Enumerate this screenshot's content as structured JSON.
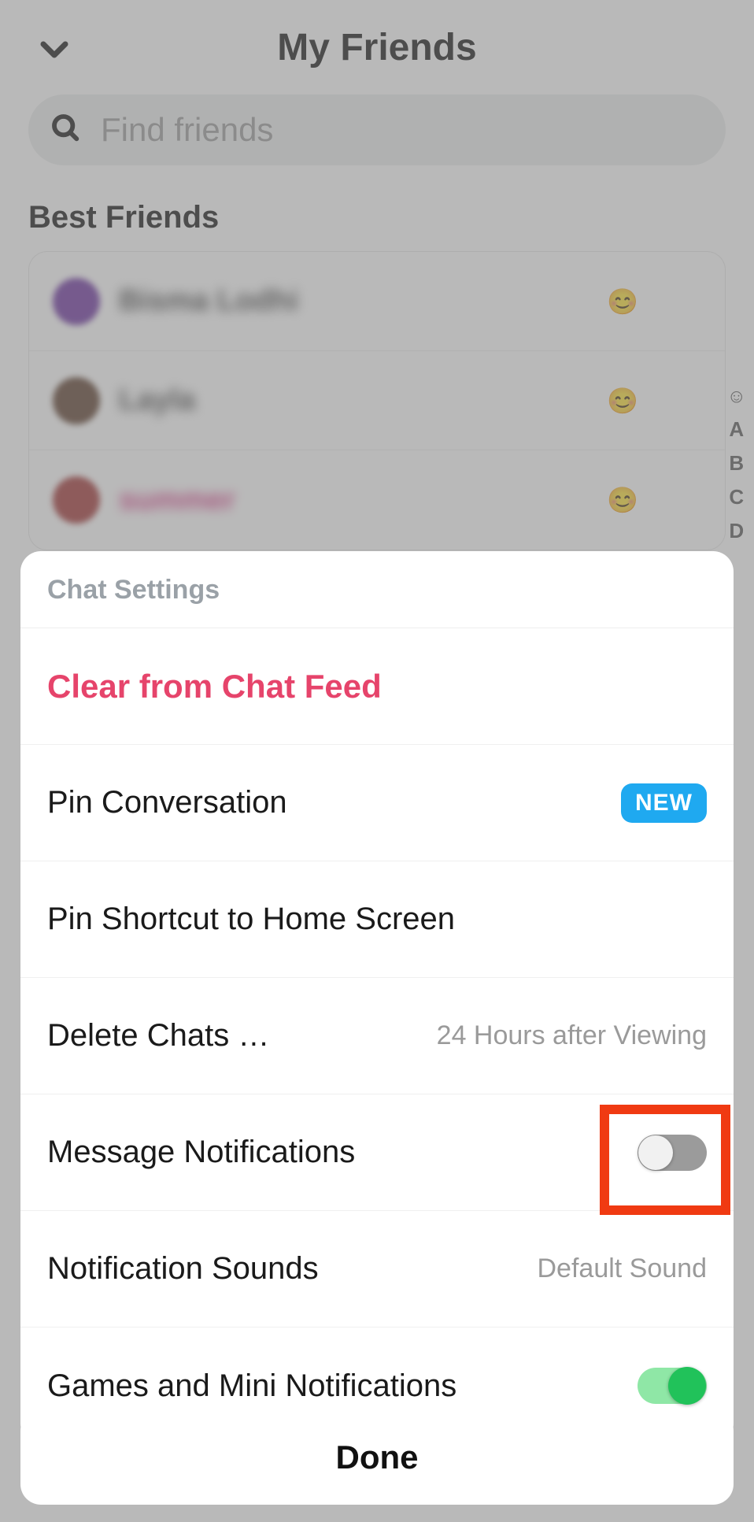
{
  "header": {
    "title": "My Friends"
  },
  "search": {
    "placeholder": "Find friends"
  },
  "section_label": "Best Friends",
  "friends": [
    {
      "name": "Bisma Lodhi",
      "emoji": "😊"
    },
    {
      "name": "Layla",
      "emoji": "😊"
    },
    {
      "name": "summer",
      "emoji": "😊"
    }
  ],
  "index_letters": [
    "A",
    "B",
    "C",
    "D"
  ],
  "sheet": {
    "title": "Chat Settings",
    "clear_label": "Clear from Chat Feed",
    "pin_conversation_label": "Pin Conversation",
    "new_badge": "NEW",
    "pin_shortcut_label": "Pin Shortcut to Home Screen",
    "delete_chats_label": "Delete Chats …",
    "delete_chats_value": "24 Hours after Viewing",
    "message_notifications_label": "Message Notifications",
    "message_notifications_on": false,
    "notification_sounds_label": "Notification Sounds",
    "notification_sounds_value": "Default Sound",
    "games_notifications_label": "Games and Mini Notifications",
    "games_notifications_on": true
  },
  "done_label": "Done"
}
